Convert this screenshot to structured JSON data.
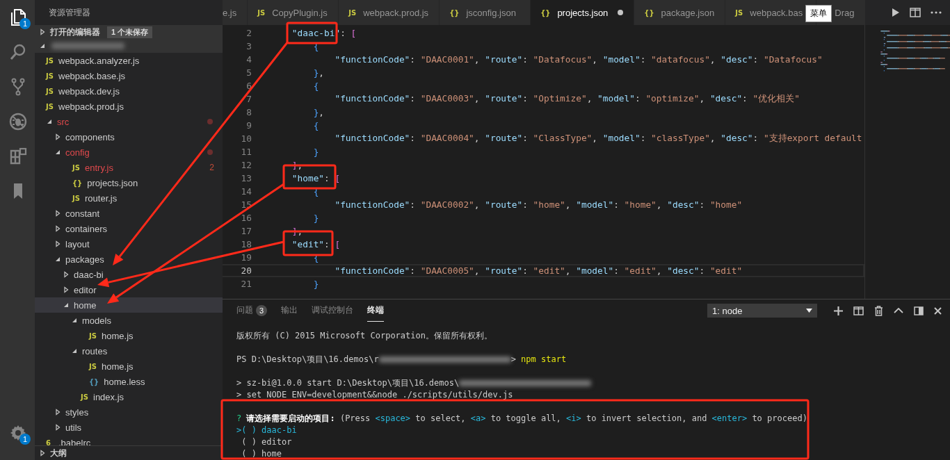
{
  "activity_bar": {
    "items": [
      {
        "kind": "files",
        "selected": true,
        "badge": "1"
      },
      {
        "kind": "search",
        "selected": false
      },
      {
        "kind": "git",
        "selected": false
      },
      {
        "kind": "debug",
        "selected": false
      },
      {
        "kind": "extensions",
        "selected": false
      },
      {
        "kind": "bookmarks",
        "selected": false
      }
    ],
    "settings_badge": "1"
  },
  "sidebar": {
    "title": "资源管理器",
    "open_editors": {
      "label": "打开的编辑器",
      "expanded": false,
      "badge": "1 个未保存"
    },
    "project": {
      "expanded": true,
      "children": [
        {
          "label": "webpack.analyzer.js",
          "icon": "JS",
          "color": "#cbcb41",
          "modified": false,
          "selected": false
        },
        {
          "label": "webpack.base.js",
          "icon": "JS",
          "color": "#cbcb41",
          "modified": false,
          "selected": false
        },
        {
          "label": "webpack.dev.js",
          "icon": "JS",
          "color": "#cbcb41",
          "modified": false,
          "selected": false
        },
        {
          "label": "webpack.prod.js",
          "icon": "JS",
          "color": "#cbcb41",
          "modified": false,
          "selected": false
        },
        {
          "label": "src",
          "expanded": true,
          "modified": true,
          "selected": false,
          "children": [
            {
              "label": "components",
              "expanded": false,
              "modified": false,
              "selected": false
            },
            {
              "label": "config",
              "expanded": true,
              "modified": true,
              "selected": false,
              "children": [
                {
                  "label": "entry.js",
                  "icon": "JS",
                  "color": "#cbcb41",
                  "modified": true,
                  "selected": false,
                  "problems": "2"
                },
                {
                  "label": "projects.json",
                  "icon": "{}",
                  "color": "#cbcb41",
                  "modified": false,
                  "selected": false
                },
                {
                  "label": "router.js",
                  "icon": "JS",
                  "color": "#cbcb41",
                  "modified": false,
                  "selected": false
                }
              ]
            },
            {
              "label": "constant",
              "expanded": false,
              "modified": false,
              "selected": false
            },
            {
              "label": "containers",
              "expanded": false,
              "modified": false,
              "selected": false
            },
            {
              "label": "layout",
              "expanded": false,
              "modified": false,
              "selected": false
            },
            {
              "label": "packages",
              "expanded": true,
              "modified": false,
              "selected": false,
              "children": [
                {
                  "label": "daac-bi",
                  "expanded": false,
                  "modified": false,
                  "selected": false
                },
                {
                  "label": "editor",
                  "expanded": false,
                  "modified": false,
                  "selected": false
                },
                {
                  "label": "home",
                  "expanded": true,
                  "modified": false,
                  "selected": true,
                  "children": [
                    {
                      "label": "models",
                      "expanded": true,
                      "modified": false,
                      "selected": false,
                      "children": [
                        {
                          "label": "home.js",
                          "icon": "JS",
                          "color": "#cbcb41",
                          "modified": false,
                          "selected": false
                        }
                      ]
                    },
                    {
                      "label": "routes",
                      "expanded": true,
                      "modified": false,
                      "selected": false,
                      "children": [
                        {
                          "label": "home.js",
                          "icon": "JS",
                          "color": "#cbcb41",
                          "modified": false,
                          "selected": false
                        },
                        {
                          "label": "home.less",
                          "icon": "{}",
                          "color": "#519aba",
                          "modified": false,
                          "selected": false
                        }
                      ]
                    },
                    {
                      "label": "index.js",
                      "icon": "JS",
                      "color": "#cbcb41",
                      "modified": false,
                      "selected": false
                    }
                  ]
                }
              ]
            },
            {
              "label": "styles",
              "expanded": false,
              "modified": false,
              "selected": false
            },
            {
              "label": "utils",
              "expanded": false,
              "modified": false,
              "selected": false
            }
          ]
        },
        {
          "label": ".babelrc",
          "icon": "6",
          "color": "#cbcb41",
          "modified": false,
          "selected": false
        }
      ]
    },
    "outline": {
      "label": "大纲",
      "expanded": false
    }
  },
  "tabs": [
    {
      "label": "e.js",
      "selected": false,
      "dirty": false
    },
    {
      "label": "CopyPlugin.js",
      "icon": "JS",
      "selected": false,
      "dirty": false
    },
    {
      "label": "webpack.prod.js",
      "icon": "JS",
      "selected": false,
      "dirty": false
    },
    {
      "label": "jsconfig.json",
      "icon": "{}",
      "selected": false,
      "dirty": false
    },
    {
      "label": "projects.json",
      "icon": "{}",
      "selected": true,
      "dirty": true
    },
    {
      "label": "package.json",
      "icon": "{}",
      "selected": false,
      "dirty": false
    },
    {
      "label": "webpack.bas",
      "icon": "JS",
      "selected": false,
      "dirty": false
    },
    {
      "label": "Drag",
      "selected": false,
      "dirty": false
    }
  ],
  "tooltip": "菜单",
  "editor": {
    "lines": [
      {
        "number": "2",
        "text": "    \"daac-bi\": [",
        "current": false
      },
      {
        "number": "3",
        "text": "        {",
        "current": false
      },
      {
        "number": "4",
        "text": "            \"functionCode\": \"DAAC0001\", \"route\": \"Datafocus\", \"model\": \"datafocus\", \"desc\": \"Datafocus\"",
        "current": false
      },
      {
        "number": "5",
        "text": "        },",
        "current": false
      },
      {
        "number": "6",
        "text": "        {",
        "current": false
      },
      {
        "number": "7",
        "text": "            \"functionCode\": \"DAAC0003\", \"route\": \"Optimize\", \"model\": \"optimize\", \"desc\": \"优化相关\"",
        "current": false
      },
      {
        "number": "8",
        "text": "        },",
        "current": false
      },
      {
        "number": "9",
        "text": "        {",
        "current": false
      },
      {
        "number": "10",
        "text": "            \"functionCode\": \"DAAC0004\", \"route\": \"ClassType\", \"model\": \"classType\", \"desc\": \"支持export default",
        "current": false
      },
      {
        "number": "11",
        "text": "        }",
        "current": false
      },
      {
        "number": "12",
        "text": "    ],",
        "current": false
      },
      {
        "number": "13",
        "text": "    \"home\": [",
        "current": false
      },
      {
        "number": "14",
        "text": "        {",
        "current": false
      },
      {
        "number": "15",
        "text": "            \"functionCode\": \"DAAC0002\", \"route\": \"home\", \"model\": \"home\", \"desc\": \"home\"",
        "current": false
      },
      {
        "number": "16",
        "text": "        }",
        "current": false
      },
      {
        "number": "17",
        "text": "    ],",
        "current": false
      },
      {
        "number": "18",
        "text": "    \"edit\": [",
        "current": false
      },
      {
        "number": "19",
        "text": "        {",
        "current": false
      },
      {
        "number": "20",
        "text": "            \"functionCode\": \"DAAC0005\", \"route\": \"edit\", \"model\": \"edit\", \"desc\": \"edit\"",
        "current": true
      },
      {
        "number": "21",
        "text": "        }",
        "current": false
      }
    ]
  },
  "panel": {
    "tabs": [
      {
        "label": "问题",
        "badge": "3",
        "selected": false
      },
      {
        "label": "输出",
        "selected": false
      },
      {
        "label": "调试控制台",
        "selected": false
      },
      {
        "label": "终端",
        "selected": true
      }
    ],
    "terminal_select": "1: node",
    "terminal": {
      "lines": [
        {
          "kind": "text",
          "segments": [
            {
              "kind": "plain",
              "text": "版权所有 (C) 2015 Microsoft Corporation。保留所有权利。"
            }
          ]
        },
        {
          "kind": "blank"
        },
        {
          "kind": "text",
          "segments": [
            {
              "kind": "plain",
              "text": "PS D:\\Desktop\\项目\\16.demos\\r"
            },
            {
              "kind": "redacted"
            },
            {
              "kind": "plain",
              "text": ">"
            },
            {
              "kind": "command",
              "text": " npm start"
            }
          ]
        },
        {
          "kind": "blank"
        },
        {
          "kind": "text",
          "segments": [
            {
              "kind": "plain",
              "text": "> sz-bi@1.0.0 start D:\\Desktop\\项目\\16.demos\\"
            },
            {
              "kind": "redacted"
            }
          ]
        },
        {
          "kind": "text",
          "segments": [
            {
              "kind": "plain",
              "text": "> set NODE ENV=development&&node ./scripts/utils/dev.js"
            }
          ]
        },
        {
          "kind": "blank"
        },
        {
          "kind": "text",
          "segments": [
            {
              "kind": "mark",
              "text": "?"
            },
            {
              "kind": "question",
              "text": " 请选择需要启动的项目:"
            },
            {
              "kind": "plain",
              "text": " (Press "
            },
            {
              "kind": "key",
              "text": "<space>"
            },
            {
              "kind": "plain",
              "text": " to select, "
            },
            {
              "kind": "key",
              "text": "<a>"
            },
            {
              "kind": "plain",
              "text": " to toggle all, "
            },
            {
              "kind": "key",
              "text": "<i>"
            },
            {
              "kind": "plain",
              "text": " to invert selection, and "
            },
            {
              "kind": "key",
              "text": "<enter>"
            },
            {
              "kind": "plain",
              "text": " to proceed)"
            }
          ]
        },
        {
          "kind": "choice",
          "pointer": ">",
          "box": "( )",
          "label": "daac-bi",
          "selected": true
        },
        {
          "kind": "choice",
          "box": "( )",
          "label": "editor",
          "selected": false
        },
        {
          "kind": "choice",
          "box": "( )",
          "label": "home",
          "selected": false
        }
      ]
    }
  }
}
